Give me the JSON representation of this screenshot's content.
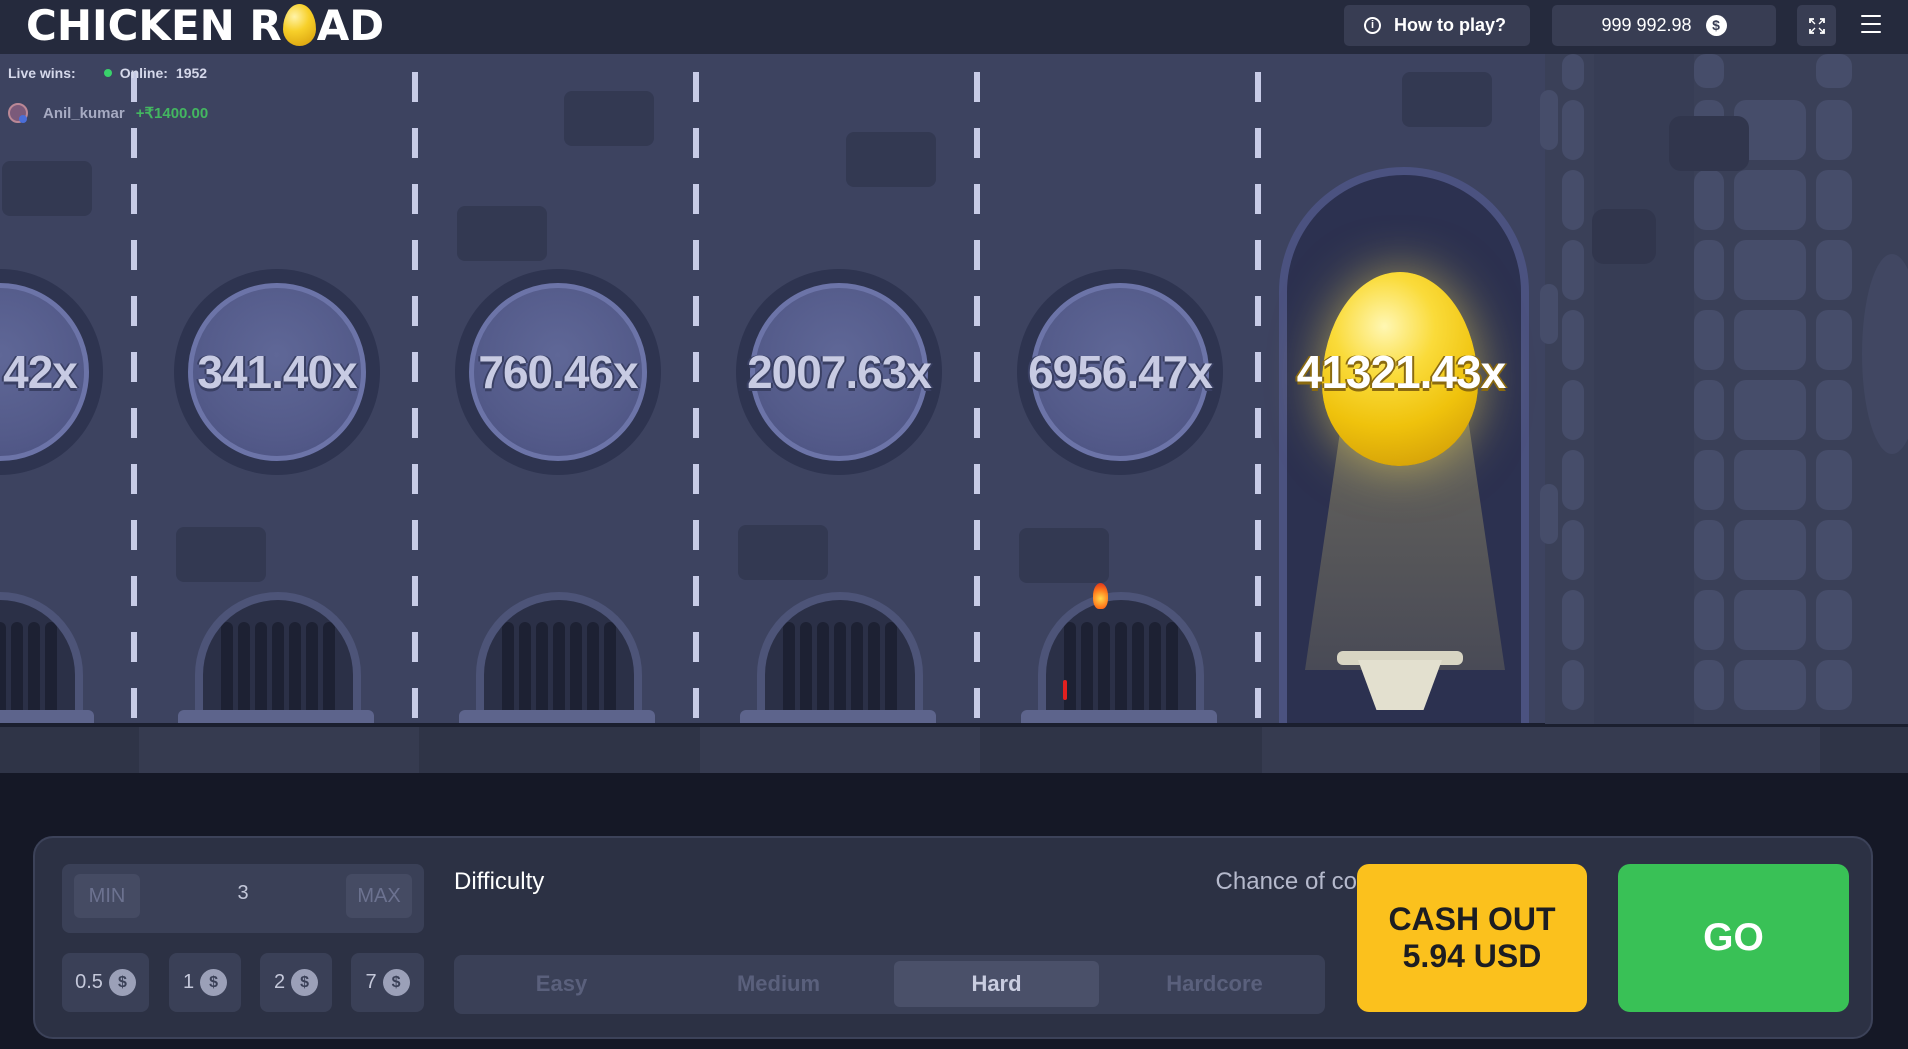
{
  "header": {
    "logo_left": "CHICKEN R",
    "logo_right": "AD",
    "how_to_play": "How to play?",
    "info_glyph": "i",
    "balance": "999 992.98",
    "currency_glyph": "$"
  },
  "live": {
    "live_wins_label": "Live wins:",
    "online_label": "Online:",
    "online_count": "1952",
    "winner_name": "Anil_kumar",
    "winner_amount": "+₹1400.00"
  },
  "multipliers": [
    "42x",
    "341.40x",
    "760.46x",
    "2007.63x",
    "6956.47x",
    "41321.43x"
  ],
  "controls": {
    "min_label": "MIN",
    "max_label": "MAX",
    "bet_value": "3",
    "quick_bets": [
      "0.5",
      "1",
      "2",
      "7"
    ],
    "difficulty_label": "Difficulty",
    "chance_label": "Chance of collision",
    "difficulties": [
      "Easy",
      "Medium",
      "Hard",
      "Hardcore"
    ],
    "active_difficulty": "Hard",
    "cashout_line1": "CASH OUT",
    "cashout_line2": "5.94 USD",
    "go_label": "GO"
  },
  "colors": {
    "cashout": "#fbc11d",
    "go": "#39c156",
    "online_dot": "#39d26b",
    "win_amount": "#43b760"
  }
}
